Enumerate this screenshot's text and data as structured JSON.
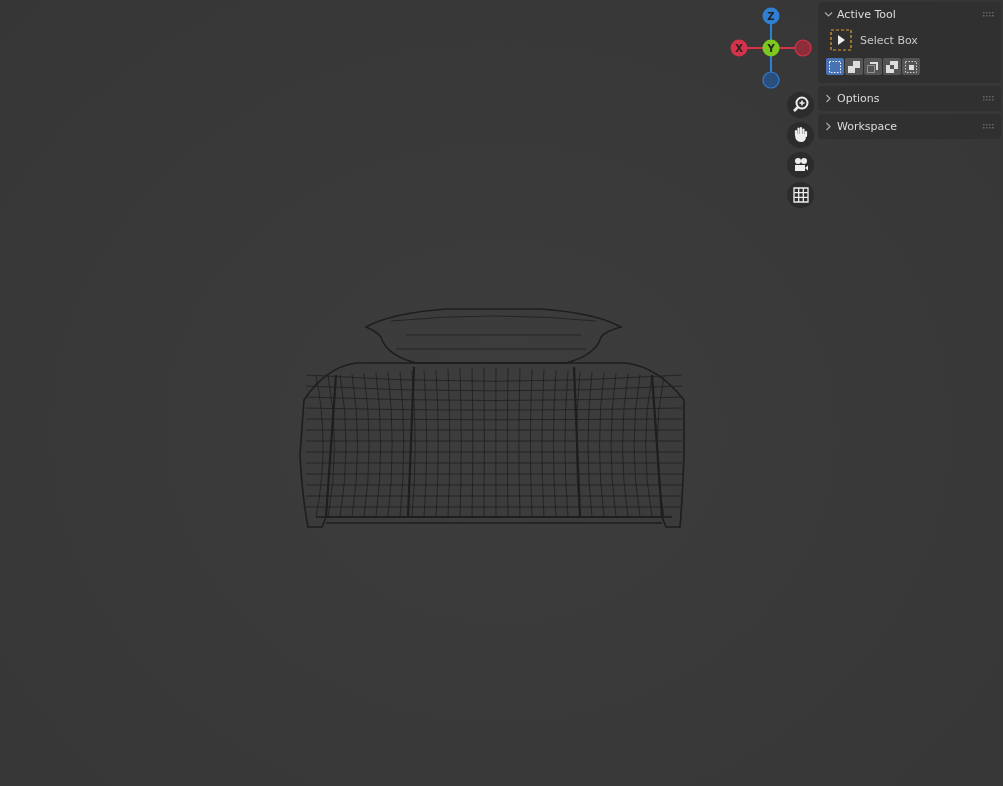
{
  "gizmo": {
    "axes": [
      {
        "kind": "x",
        "label": "X"
      },
      {
        "kind": "y",
        "label": "Y"
      },
      {
        "kind": "z",
        "label": "Z"
      }
    ]
  },
  "nav_buttons": [
    {
      "kind": "zoom"
    },
    {
      "kind": "pan"
    },
    {
      "kind": "camera"
    },
    {
      "kind": "grid"
    }
  ],
  "sidebar": {
    "sections": [
      {
        "title": "Active Tool",
        "expanded": true,
        "tool": {
          "name": "Select Box"
        },
        "modes": [
          {
            "kind": "new",
            "selected": true
          },
          {
            "kind": "extend",
            "selected": false
          },
          {
            "kind": "subtract",
            "selected": false
          },
          {
            "kind": "invert",
            "selected": false
          },
          {
            "kind": "intersect",
            "selected": false
          }
        ]
      },
      {
        "title": "Options",
        "expanded": false
      },
      {
        "title": "Workspace",
        "expanded": false
      }
    ]
  }
}
